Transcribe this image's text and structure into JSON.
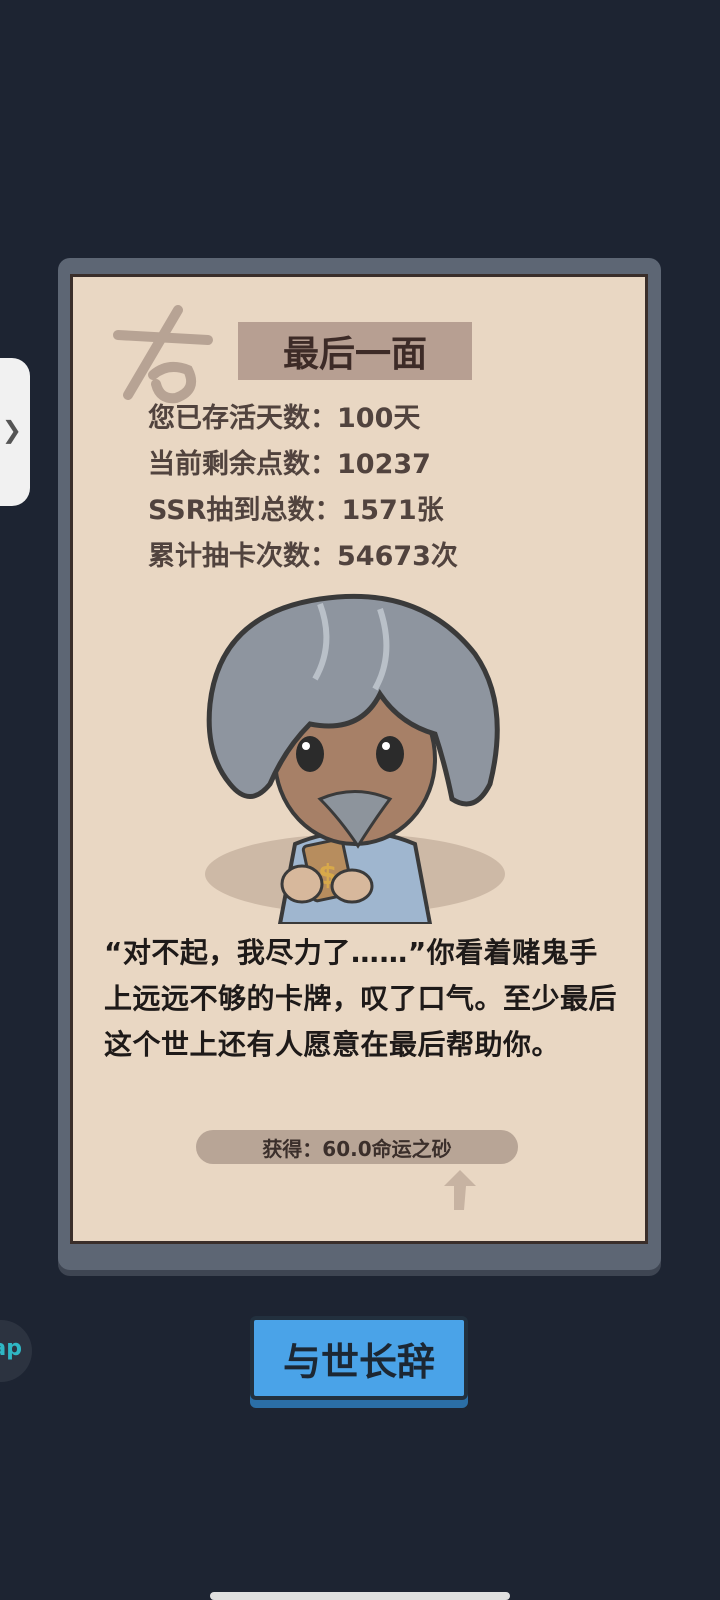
{
  "title": "最后一面",
  "stats": [
    {
      "label": "您已存活天数：",
      "value": "100天"
    },
    {
      "label": "当前剩余点数：",
      "value": "10237"
    },
    {
      "label": "SSR抽到总数：",
      "value": "1571张"
    },
    {
      "label": "累计抽卡次数：",
      "value": "54673次"
    }
  ],
  "story": "“对不起，我尽力了……”你看着赌鬼手上远远不够的卡牌，叹了口气。至少最后这个世上还有人愿意在最后帮助你。",
  "reward": "获得：60.0命运之砂",
  "button_label": "与世长辞",
  "floating_label": "ap",
  "side_handle_icon": "chevron-right-icon",
  "colors": {
    "background": "#1d2432",
    "paper": "#e9d7c3",
    "button": "#4aa3e8",
    "frame": "#5d6674"
  }
}
